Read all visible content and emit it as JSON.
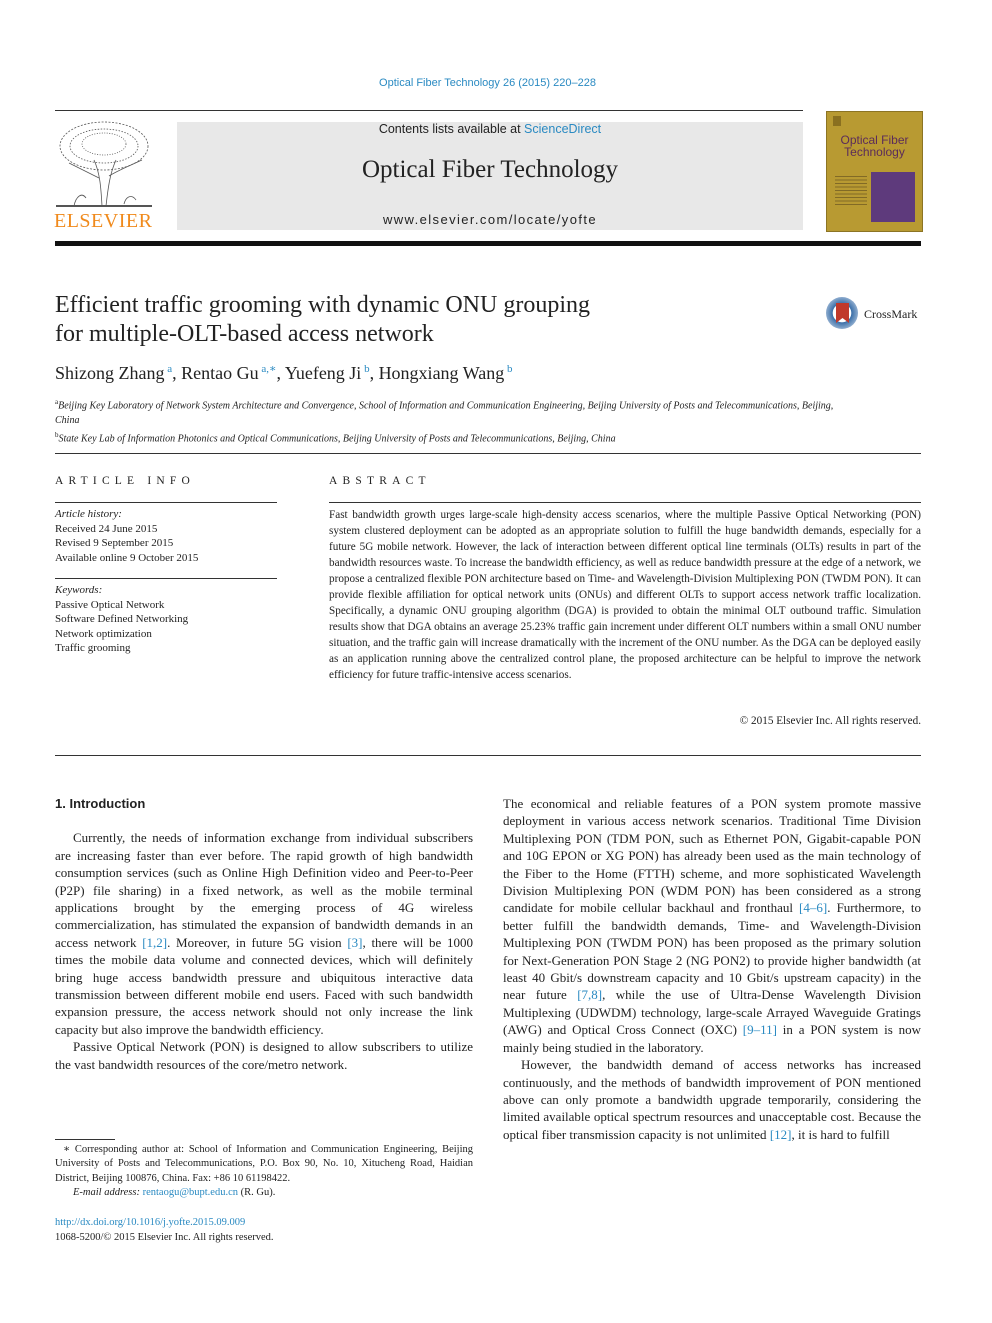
{
  "header": {
    "journal_ref": "Optical Fiber Technology 26 (2015) 220–228",
    "contents_prefix": "Contents lists available at ",
    "contents_link": "ScienceDirect",
    "journal_title": "Optical Fiber Technology",
    "journal_url": "www.elsevier.com/locate/yofte",
    "publisher_logo_text": "ELSEVIER",
    "cover_title": "Optical Fiber Technology",
    "colors": {
      "link": "#2a8ac2",
      "elsevier_orange": "#f08a1c",
      "cover_gold": "#b89a32",
      "cover_purple": "#5e3a7c"
    }
  },
  "article": {
    "title_line1": "Efficient traffic grooming with dynamic ONU grouping",
    "title_line2": "for multiple-OLT-based access network",
    "crossmark_label": "CrossMark",
    "authors": [
      {
        "name": "Shizong Zhang",
        "sup": "a"
      },
      {
        "name": "Rentao Gu",
        "sup": "a,∗"
      },
      {
        "name": "Yuefeng Ji",
        "sup": "b"
      },
      {
        "name": "Hongxiang Wang",
        "sup": "b"
      }
    ],
    "affiliations": [
      {
        "sup": "a",
        "text": "Beijing Key Laboratory of Network System Architecture and Convergence, School of Information and Communication Engineering, Beijing University of Posts and Telecommunications, Beijing, China"
      },
      {
        "sup": "b",
        "text": "State Key Lab of Information Photonics and Optical Communications, Beijing University of Posts and Telecommunications, Beijing, China"
      }
    ]
  },
  "article_info": {
    "heading": "ARTICLE INFO",
    "history_label": "Article history:",
    "history": [
      "Received 24 June 2015",
      "Revised 9 September 2015",
      "Available online 9 October 2015"
    ],
    "keywords_label": "Keywords:",
    "keywords": [
      "Passive Optical Network",
      "Software Defined Networking",
      "Network optimization",
      "Traffic grooming"
    ]
  },
  "abstract": {
    "heading": "ABSTRACT",
    "text": "Fast bandwidth growth urges large-scale high-density access scenarios, where the multiple Passive Optical Networking (PON) system clustered deployment can be adopted as an appropriate solution to fulfill the huge bandwidth demands, especially for a future 5G mobile network. However, the lack of interaction between different optical line terminals (OLTs) results in part of the bandwidth resources waste. To increase the bandwidth efficiency, as well as reduce bandwidth pressure at the edge of a network, we propose a centralized flexible PON architecture based on Time- and Wavelength-Division Multiplexing PON (TWDM PON). It can provide flexible affiliation for optical network units (ONUs) and different OLTs to support access network traffic localization. Specifically, a dynamic ONU grouping algorithm (DGA) is provided to obtain the minimal OLT outbound traffic. Simulation results show that DGA obtains an average 25.23% traffic gain increment under different OLT numbers within a small ONU number situation, and the traffic gain will increase dramatically with the increment of the ONU number. As the DGA can be deployed easily as an application running above the centralized control plane, the proposed architecture can be helpful to improve the network efficiency for future traffic-intensive access scenarios.",
    "copyright": "© 2015 Elsevier Inc. All rights reserved."
  },
  "body": {
    "section_heading": "1. Introduction",
    "left_p1": [
      {
        "t": "Currently, the needs of information exchange from individual subscribers are increasing faster than ever before. The rapid growth of high bandwidth consumption services (such as Online High Definition video and Peer-to-Peer (P2P) file sharing) in a fixed network, as well as the mobile terminal applications brought by the emerging process of 4G wireless commercialization, has stimulated the expansion of bandwidth demands in an access network "
      },
      {
        "ref": "[1,2]"
      },
      {
        "t": ". Moreover, in future 5G vision "
      },
      {
        "ref": "[3]"
      },
      {
        "t": ", there will be 1000 times the mobile data volume and connected devices, which will definitely bring huge access bandwidth pressure and ubiquitous interactive data transmission between different mobile end users. Faced with such bandwidth expansion pressure, the access network should not only increase the link capacity but also improve the bandwidth efficiency."
      }
    ],
    "left_p2": "Passive Optical Network (PON) is designed to allow subscribers to utilize the vast bandwidth resources of the core/metro network.",
    "right_p1": [
      {
        "t": "The economical and reliable features of a PON system promote massive deployment in various access network scenarios. Traditional Time Division Multiplexing PON (TDM PON, such as Ethernet PON, Gigabit-capable PON and 10G EPON or XG PON) has already been used as the main technology of the Fiber to the Home (FTTH) scheme, and more sophisticated Wavelength Division Multiplexing PON (WDM PON) has been considered as a strong candidate for mobile cellular backhaul and fronthaul "
      },
      {
        "ref": "[4–6]"
      },
      {
        "t": ". Furthermore, to better fulfill the bandwidth demands, Time- and Wavelength-Division Multiplexing PON (TWDM PON) has been proposed as the primary solution for Next-Generation PON Stage 2 (NG PON2) to provide higher bandwidth (at least 40 Gbit/s downstream capacity and 10 Gbit/s upstream capacity) in the near future "
      },
      {
        "ref": "[7,8]"
      },
      {
        "t": ", while the use of Ultra-Dense Wavelength Division Multiplexing (UDWDM) technology, large-scale Arrayed Waveguide Gratings (AWG) and Optical Cross Connect (OXC) "
      },
      {
        "ref": "[9–11]"
      },
      {
        "t": " in a PON system is now mainly being studied in the laboratory."
      }
    ],
    "right_p2": [
      {
        "t": "However, the bandwidth demand of access networks has increased continuously, and the methods of bandwidth improvement of PON mentioned above can only promote a bandwidth upgrade temporarily, considering the limited available optical spectrum resources and unacceptable cost. Because the optical fiber transmission capacity is not unlimited "
      },
      {
        "ref": "[12]"
      },
      {
        "t": ", it is hard to fulfill"
      }
    ]
  },
  "footnote": {
    "corresponding": "∗ Corresponding author at: School of Information and Communication Engineering, Beijing University of Posts and Telecommunications, P.O. Box 90, No. 10, Xitucheng Road, Haidian District, Beijing 100876, China. Fax: +86 10 61198422.",
    "email_label": "E-mail address: ",
    "email": "rentaogu@bupt.edu.cn",
    "email_suffix": " (R. Gu).",
    "doi": "http://dx.doi.org/10.1016/j.yofte.2015.09.009",
    "issn": "1068-5200/© 2015 Elsevier Inc. All rights reserved."
  }
}
